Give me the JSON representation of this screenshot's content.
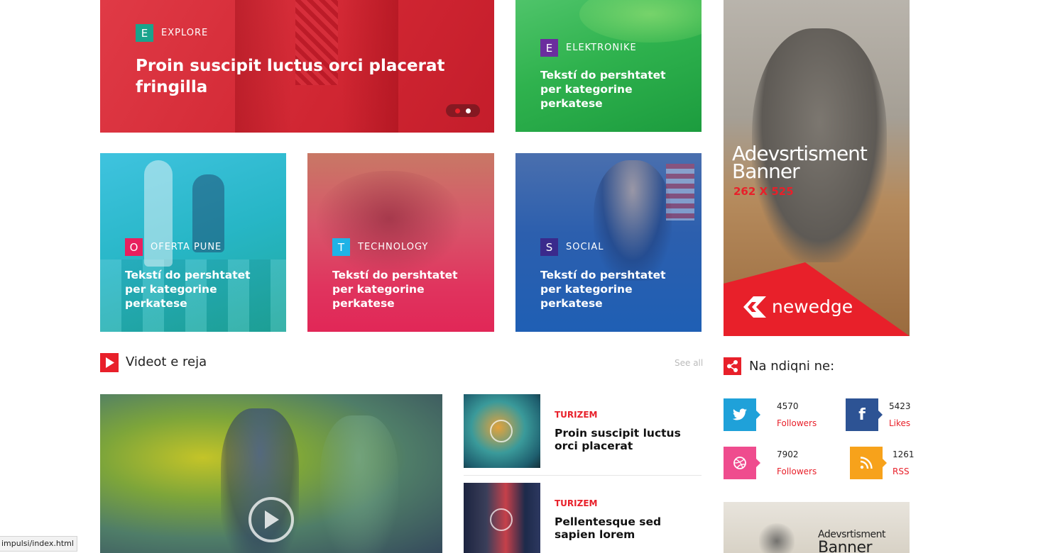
{
  "featured": {
    "main": {
      "category_letter": "E",
      "category": "EXPLORE",
      "title": "Proin suscipit luctus orci placerat fringilla",
      "badge_color": "#1aa38c"
    },
    "side": {
      "category_letter": "E",
      "category": "ELEKTRONIKE",
      "title": "Tekstí do pershtatet per kategorine perkatese",
      "badge_color": "#6b2d9e"
    }
  },
  "cards": [
    {
      "category_letter": "O",
      "category": "OFERTA PUNE",
      "title": "Tekstí do pershtatet per kategorine perkatese",
      "badge_color": "#e8205e"
    },
    {
      "category_letter": "T",
      "category": "TECHNOLOGY",
      "title": "Tekstí do pershtatet per kategorine perkatese",
      "badge_color": "#1fb3e6"
    },
    {
      "category_letter": "S",
      "category": "SOCIAL",
      "title": "Tekstí do pershtatet per kategorine perkatese",
      "badge_color": "#3a2a8c"
    }
  ],
  "ad_banner": {
    "title_line1": "Adevsrtisment",
    "title_line2": "Banner",
    "size": "262 X 525",
    "brand": "newedge"
  },
  "videos": {
    "section_title": "Videot e reja",
    "see_all": "See all",
    "items": [
      {
        "category": "TURIZEM",
        "title": "Proin suscipit luctus orci placerat"
      },
      {
        "category": "TURIZEM",
        "title": "Pellentesque sed sapien lorem"
      }
    ]
  },
  "follow": {
    "section_title": "Na ndiqni ne:",
    "networks": [
      {
        "icon": "twitter-icon",
        "count": "4570",
        "label": "Followers",
        "color": "#1fa1d9"
      },
      {
        "icon": "facebook-icon",
        "count": "5423",
        "label": "Likes",
        "color": "#2d5394"
      },
      {
        "icon": "dribbble-icon",
        "count": "7902",
        "label": "Followers",
        "color": "#ef4c8e"
      },
      {
        "icon": "rss-icon",
        "count": "1261",
        "label": "RSS",
        "color": "#f7a21b"
      }
    ]
  },
  "ad_banner_2": {
    "title_line1": "Adevsrtisment",
    "title_line2": "Banner"
  },
  "status_bar": {
    "url": "impulsi/index.html"
  }
}
